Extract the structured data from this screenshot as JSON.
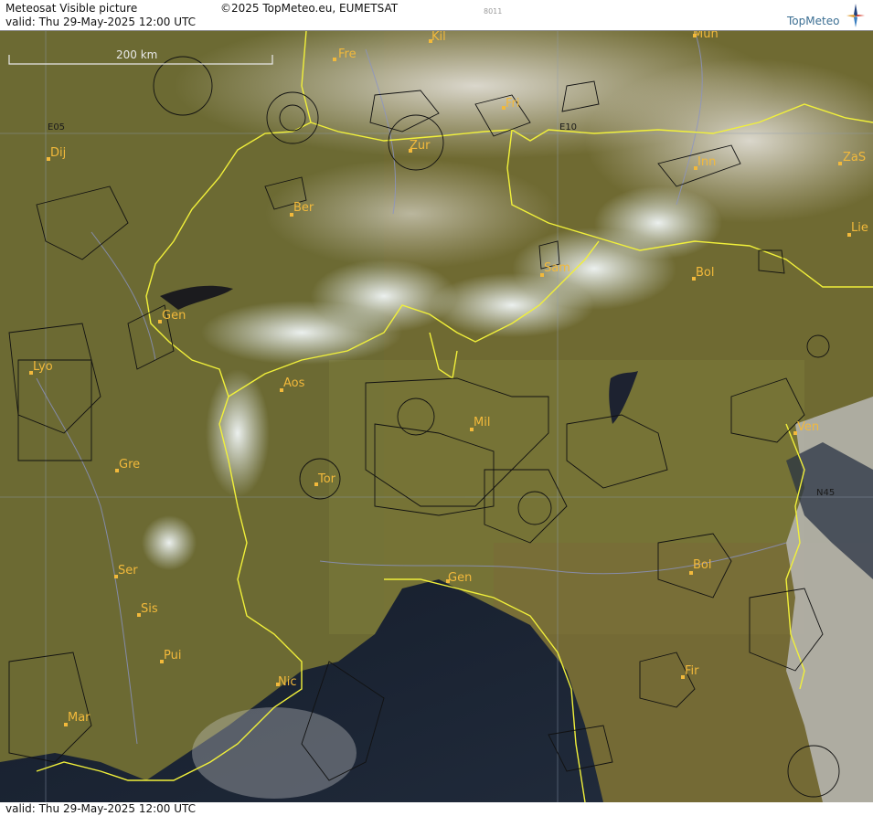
{
  "header": {
    "title": "Meteosat Visible picture",
    "valid": "valid:  Thu  29-May-2025  12:00 UTC",
    "copyright": "©2025 TopMeteo.eu, EUMETSAT",
    "code": "8011",
    "brand": "TopMeteo"
  },
  "footer": {
    "valid": "valid:  Thu  29-May-2025  12:00 UTC"
  },
  "scale": {
    "label": "200 km"
  },
  "grid_labels": {
    "e05": "E05",
    "e10": "E10",
    "n45": "N45"
  },
  "cities": [
    {
      "id": "fre",
      "name": "Fre"
    },
    {
      "id": "kil",
      "name": "Kil"
    },
    {
      "id": "mun",
      "name": "Mun"
    },
    {
      "id": "dij",
      "name": "Dij"
    },
    {
      "id": "fri",
      "name": "Fri"
    },
    {
      "id": "zur",
      "name": "Zur"
    },
    {
      "id": "inn",
      "name": "Inn"
    },
    {
      "id": "zas",
      "name": "ZaS"
    },
    {
      "id": "ber",
      "name": "Ber"
    },
    {
      "id": "lie",
      "name": "Lie"
    },
    {
      "id": "sam",
      "name": "Sam"
    },
    {
      "id": "bol-n",
      "name": "Bol"
    },
    {
      "id": "gen-ch",
      "name": "Gen"
    },
    {
      "id": "lyo",
      "name": "Lyo"
    },
    {
      "id": "aos",
      "name": "Aos"
    },
    {
      "id": "mil",
      "name": "Mil"
    },
    {
      "id": "ven",
      "name": "Ven"
    },
    {
      "id": "gre",
      "name": "Gre"
    },
    {
      "id": "tor",
      "name": "Tor"
    },
    {
      "id": "ser",
      "name": "Ser"
    },
    {
      "id": "bol-s",
      "name": "Bol"
    },
    {
      "id": "gen-it",
      "name": "Gen"
    },
    {
      "id": "sis",
      "name": "Sis"
    },
    {
      "id": "pui",
      "name": "Pui"
    },
    {
      "id": "nic",
      "name": "Nic"
    },
    {
      "id": "fir",
      "name": "Fir"
    },
    {
      "id": "mar",
      "name": "Mar"
    }
  ]
}
